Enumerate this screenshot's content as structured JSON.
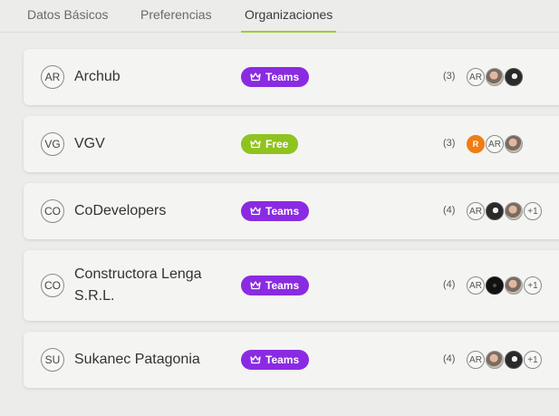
{
  "tabs": [
    {
      "label": "Datos Básicos"
    },
    {
      "label": "Preferencias"
    },
    {
      "label": "Organizaciones"
    }
  ],
  "accent_color": "#9acd32",
  "plan_colors": {
    "Teams": "#8a2be2",
    "Free": "#8fc31f"
  },
  "organizations": [
    {
      "initials": "AR",
      "name": "Archub",
      "plan": "Teams",
      "count": "(3)",
      "members": [
        {
          "type": "initials",
          "text": "AR"
        },
        {
          "type": "photo"
        },
        {
          "type": "photo"
        }
      ]
    },
    {
      "initials": "VG",
      "name": "VGV",
      "plan": "Free",
      "count": "(3)",
      "members": [
        {
          "type": "initials",
          "text": "R"
        },
        {
          "type": "initials",
          "text": "AR"
        },
        {
          "type": "photo"
        }
      ]
    },
    {
      "initials": "CO",
      "name": "CoDevelopers",
      "plan": "Teams",
      "count": "(4)",
      "members": [
        {
          "type": "initials",
          "text": "AR"
        },
        {
          "type": "photo"
        },
        {
          "type": "photo"
        },
        {
          "type": "more",
          "text": "+1"
        }
      ]
    },
    {
      "initials": "CO",
      "name": "Constructora Lenga S.R.L.",
      "plan": "Teams",
      "count": "(4)",
      "members": [
        {
          "type": "initials",
          "text": "AR"
        },
        {
          "type": "photo"
        },
        {
          "type": "photo"
        },
        {
          "type": "more",
          "text": "+1"
        }
      ]
    },
    {
      "initials": "SU",
      "name": "Sukanec Patagonia",
      "plan": "Teams",
      "count": "(4)",
      "members": [
        {
          "type": "initials",
          "text": "AR"
        },
        {
          "type": "photo"
        },
        {
          "type": "photo"
        },
        {
          "type": "more",
          "text": "+1"
        }
      ]
    }
  ]
}
